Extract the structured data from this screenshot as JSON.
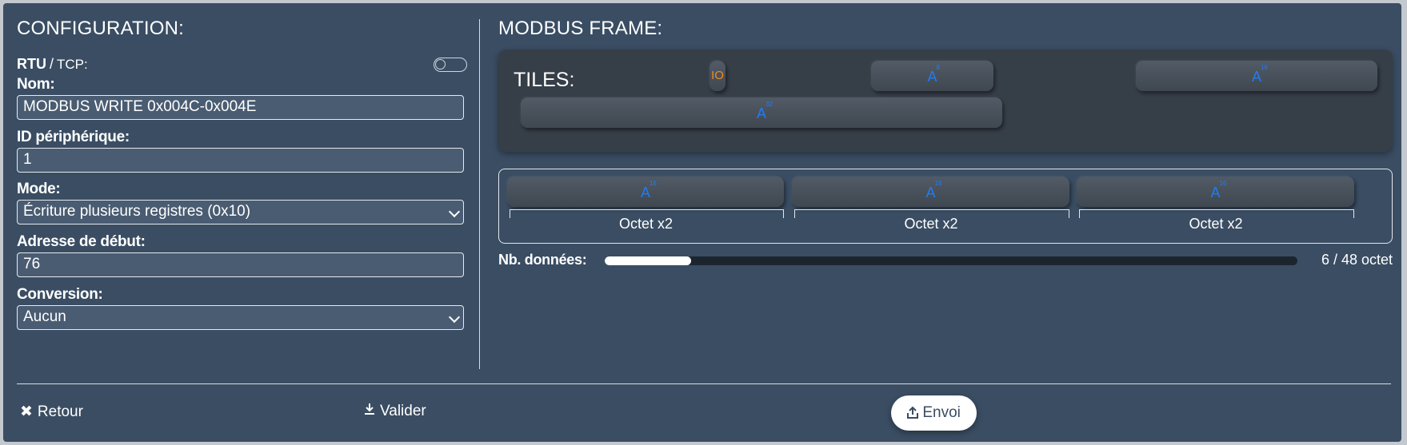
{
  "config": {
    "title": "CONFIGURATION:",
    "protocol": {
      "rtu": "RTU",
      "separator": "/",
      "tcp": "TCP:"
    },
    "fields": [
      {
        "label": "Nom:",
        "value": "MODBUS WRITE 0x004C-0x004E"
      },
      {
        "label": "ID périphérique:",
        "value": "1"
      },
      {
        "label": "Mode:",
        "value": "Écriture plusieurs registres (0x10)"
      },
      {
        "label": "Adresse de début:",
        "value": "76"
      },
      {
        "label": "Conversion:",
        "value": "Aucun"
      }
    ]
  },
  "frame": {
    "title": "MODBUS FRAME:",
    "tiles_label": "TILES:",
    "tiles": [
      {
        "text": "IO"
      },
      {
        "text": "A",
        "sup": "8"
      },
      {
        "text": "A",
        "sup": "16"
      },
      {
        "text": "A",
        "sup": "32"
      }
    ],
    "bytes": [
      {
        "text": "A",
        "sup": "16",
        "label": "Octet x2"
      },
      {
        "text": "A",
        "sup": "16",
        "label": "Octet x2"
      },
      {
        "text": "A",
        "sup": "16",
        "label": "Octet x2"
      }
    ],
    "nb_label": "Nb. données:",
    "nb_count": "6 / 48 octet",
    "nb_fraction": 0.125
  },
  "footer": {
    "back": "Retour",
    "validate": "Valider",
    "send": "Envoi"
  },
  "colors": {
    "panel": "#3a4d63",
    "accent": "#1f7cf5",
    "io": "#f28b1e"
  }
}
